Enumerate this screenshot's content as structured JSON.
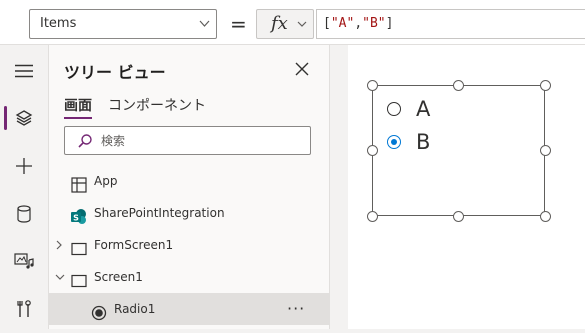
{
  "formula_bar": {
    "property": "Items",
    "equals": "=",
    "fx_label": "fx",
    "formula_tokens": [
      "[",
      "\"A\"",
      ",",
      "\"B\"",
      "]"
    ]
  },
  "rail": {
    "icons": [
      "hamburger-icon",
      "layers-icon",
      "add-icon",
      "database-icon",
      "media-icon",
      "tools-icon"
    ],
    "active_index": 1,
    "accent_color": "#742774"
  },
  "tree_panel": {
    "title": "ツリー ビュー",
    "tabs": [
      {
        "label": "画面",
        "selected": true
      },
      {
        "label": "コンポーネント",
        "selected": false
      }
    ],
    "search_placeholder": "検索",
    "items": [
      {
        "label": "App",
        "icon": "app-icon",
        "expandable": false,
        "selected": false
      },
      {
        "label": "SharePointIntegration",
        "icon": "sharepoint-icon",
        "expandable": false,
        "selected": false
      },
      {
        "label": "FormScreen1",
        "icon": "screen-icon",
        "expandable": true,
        "expanded": false,
        "selected": false
      },
      {
        "label": "Screen1",
        "icon": "screen-icon",
        "expandable": true,
        "expanded": true,
        "selected": false
      },
      {
        "label": "Radio1",
        "icon": "radio-icon",
        "expandable": false,
        "selected": true,
        "more": "···"
      }
    ]
  },
  "canvas": {
    "radio_options": [
      {
        "label": "A",
        "checked": false
      },
      {
        "label": "B",
        "checked": true
      }
    ],
    "checked_color": "#0078d4"
  }
}
